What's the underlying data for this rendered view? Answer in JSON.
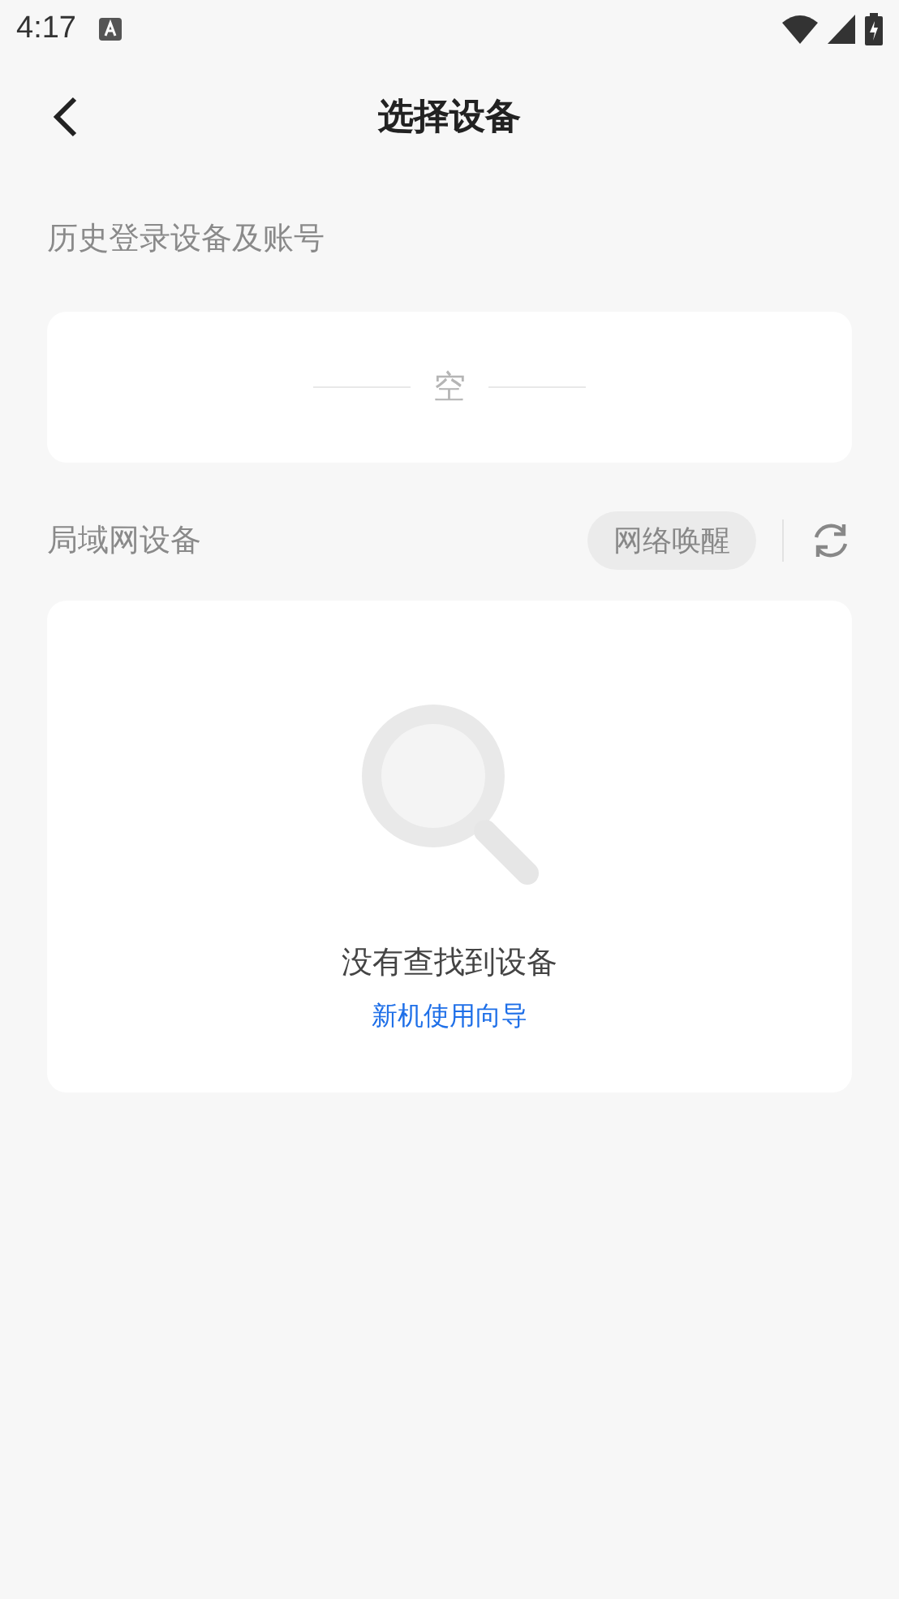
{
  "status_bar": {
    "time": "4:17"
  },
  "header": {
    "title": "选择设备"
  },
  "history": {
    "label": "历史登录设备及账号",
    "empty_text": "空"
  },
  "lan": {
    "label": "局域网设备",
    "wake_button": "网络唤醒",
    "empty_title": "没有查找到设备",
    "guide_link": "新机使用向导"
  }
}
